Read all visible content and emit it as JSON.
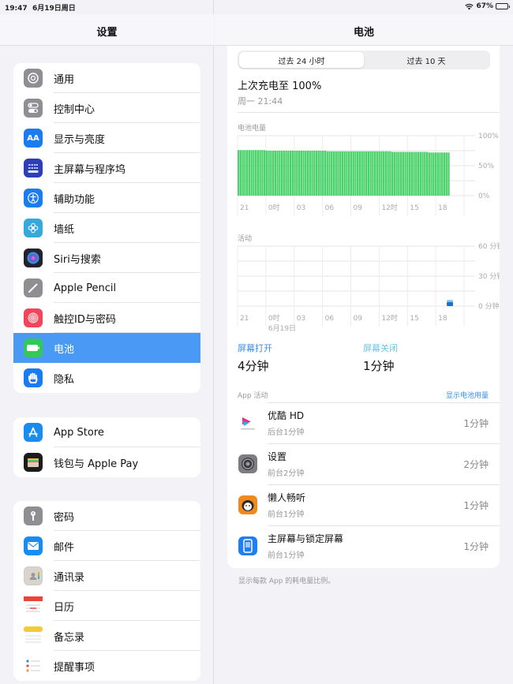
{
  "status_bar": {
    "time": "19:47",
    "date": "6月19日周日",
    "battery_percent_text": "67%",
    "battery_level": 0.67
  },
  "sidebar": {
    "title": "设置",
    "groups": [
      {
        "items": [
          {
            "label": "通用",
            "icon": "gear-icon",
            "color": "#8e8e93"
          },
          {
            "label": "控制中心",
            "icon": "toggles-icon",
            "color": "#8e8e93"
          },
          {
            "label": "显示与亮度",
            "icon": "text-size-icon",
            "color": "#1a7cf0",
            "glyph": "AA"
          },
          {
            "label": "主屏幕与程序坞",
            "icon": "home-grid-icon",
            "color": "#2d3eb6"
          },
          {
            "label": "辅助功能",
            "icon": "accessibility-icon",
            "color": "#1a7cf0"
          },
          {
            "label": "墙纸",
            "icon": "wallpaper-flower-icon",
            "color": "#36a9dc"
          },
          {
            "label": "Siri与搜索",
            "icon": "siri-icon",
            "color": "#222230"
          },
          {
            "label": "Apple Pencil",
            "icon": "pencil-icon",
            "color": "#8e8e93"
          },
          {
            "label": "触控ID与密码",
            "icon": "fingerprint-icon",
            "color": "#f0455a"
          },
          {
            "label": "电池",
            "icon": "battery-icon",
            "color": "#34c759",
            "selected": true
          },
          {
            "label": "隐私",
            "icon": "hand-icon",
            "color": "#1a7cf0"
          }
        ]
      },
      {
        "items": [
          {
            "label": "App Store",
            "icon": "app-store-icon",
            "color": "#1a8cf0"
          },
          {
            "label": "钱包与 Apple Pay",
            "icon": "wallet-icon",
            "color": "#1c1c1e"
          }
        ]
      },
      {
        "items": [
          {
            "label": "密码",
            "icon": "key-icon",
            "color": "#8e8e93"
          },
          {
            "label": "邮件",
            "icon": "mail-icon",
            "color": "#1a8cf0"
          },
          {
            "label": "通讯录",
            "icon": "contacts-icon",
            "color": "#d8d4cc"
          },
          {
            "label": "日历",
            "icon": "calendar-icon",
            "color": "#ffffff"
          },
          {
            "label": "备忘录",
            "icon": "notes-icon",
            "color": "#ffffff"
          },
          {
            "label": "提醒事项",
            "icon": "reminders-icon",
            "color": "#ffffff"
          }
        ]
      }
    ]
  },
  "main": {
    "title": "电池",
    "segments": [
      {
        "label": "过去 24 小时",
        "active": true
      },
      {
        "label": "过去 10 天",
        "active": false
      }
    ],
    "last_charged": {
      "title": "上次充电至 100%",
      "subtitle": "周一 21:44"
    },
    "screen_on": {
      "label": "屏幕打开",
      "value": "4分钟",
      "color": "#3a8ee6"
    },
    "screen_off": {
      "label": "屏幕关闭",
      "value": "1分钟",
      "color": "#6cc4e0"
    },
    "app_activity_label": "App 活动",
    "show_usage_link": "显示电池用量",
    "apps": [
      {
        "name": "优酷 HD",
        "detail": "后台1分钟",
        "time": "1分钟",
        "icon": "youku-icon"
      },
      {
        "name": "设置",
        "detail": "前台2分钟",
        "time": "2分钟",
        "icon": "settings-gear-icon"
      },
      {
        "name": "懒人畅听",
        "detail": "前台1分钟",
        "time": "1分钟",
        "icon": "lanren-icon"
      },
      {
        "name": "主屏幕与锁定屏幕",
        "detail": "前台1分钟",
        "time": "1分钟",
        "icon": "home-lock-screen-icon"
      }
    ],
    "footer_note": "显示每款 App 的耗电量比例。"
  },
  "chart_data": [
    {
      "type": "bar",
      "title": "电池电量",
      "x_tick_labels": [
        "21",
        "0时",
        "03",
        "06",
        "09",
        "12时",
        "15",
        "18"
      ],
      "y_tick_labels": [
        "100%",
        "50%",
        "0%"
      ],
      "ylim": [
        0,
        100
      ],
      "grid": true,
      "bar_color": "#4cd26b",
      "values": [
        76,
        76,
        76,
        76,
        76,
        76,
        76,
        76,
        76,
        76,
        76,
        76,
        76,
        75,
        75,
        75,
        75,
        75,
        75,
        75,
        75,
        75,
        75,
        75,
        75,
        75,
        75,
        75,
        75,
        75,
        75,
        75,
        75,
        75,
        75,
        75,
        75,
        75,
        75,
        75,
        75,
        74,
        74,
        74,
        74,
        74,
        74,
        74,
        74,
        74,
        74,
        74,
        74,
        74,
        74,
        74,
        74,
        74,
        74,
        74,
        74,
        74,
        74,
        74,
        74,
        74,
        74,
        74,
        74,
        74,
        74,
        73,
        73,
        73,
        73,
        73,
        73,
        73,
        73,
        73,
        73,
        73,
        73,
        73,
        73,
        73,
        73,
        73,
        72,
        72,
        72,
        72,
        72,
        72,
        72,
        72,
        72,
        72
      ]
    },
    {
      "type": "bar",
      "title": "活动",
      "x_tick_labels": [
        "21",
        "0时",
        "03",
        "06",
        "09",
        "12时",
        "15",
        "18"
      ],
      "x_sublabel": "6月19日",
      "y_tick_labels": [
        "60 分钟",
        "30 分钟",
        "0 分钟"
      ],
      "ylim": [
        0,
        60
      ],
      "grid": true,
      "series": [
        {
          "name": "屏幕打开",
          "color": "#1a6fd6",
          "values": [
            0,
            0,
            0,
            0,
            0,
            0,
            0,
            0,
            0,
            0,
            0,
            0,
            0,
            0,
            0,
            0,
            0,
            0,
            0,
            0,
            0,
            0,
            4
          ]
        },
        {
          "name": "屏幕关闭",
          "color": "#6cc4e0",
          "values": [
            0,
            0,
            0,
            0,
            0,
            0,
            0,
            0,
            0,
            0,
            0,
            0,
            0,
            0,
            0,
            0,
            0,
            0,
            0,
            0,
            0,
            0,
            1
          ]
        }
      ]
    }
  ]
}
